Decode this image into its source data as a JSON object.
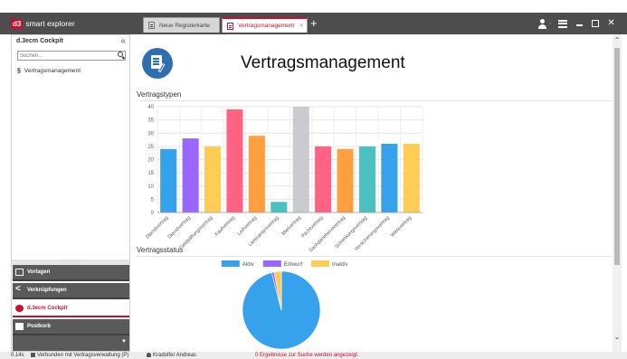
{
  "app": {
    "logo_mark": "d3",
    "logo_text": "smart explorer"
  },
  "tabs": [
    {
      "label": "Neue Registerkarte",
      "active": false
    },
    {
      "label": "Vertragsmanagement",
      "active": true
    }
  ],
  "sidebar": {
    "title": "d.3ecm Cockpit",
    "collapse_glyph": "«",
    "search_placeholder": "Suchen...",
    "tree_items": [
      {
        "symbol": "§",
        "label": "Vertragsmanagement"
      }
    ],
    "nav": [
      {
        "label": "Vorlagen",
        "icon": "document-icon",
        "active": false
      },
      {
        "label": "Verknüpfungen",
        "icon": "share-icon",
        "active": false
      },
      {
        "label": "d.3ecm Cockpit",
        "icon": "cockpit-icon",
        "active": true
      },
      {
        "label": "Postkorb",
        "icon": "mail-icon",
        "active": false
      }
    ]
  },
  "main": {
    "title": "Vertragsmanagement",
    "section_types": "Vertragstypen",
    "section_status": "Vertragsstatus"
  },
  "statusbar": {
    "time": "0.14s",
    "connection": "Verbunden mit Vertragsverwaltung (P)",
    "user": "Kradolfer Andreas",
    "message": "0 Ergebnisse zur Suche werden angezeigt."
  },
  "chart_data": [
    {
      "type": "bar",
      "categories": [
        "Dienstvertrag",
        "Dienstvertrag",
        "Geldstiftungsvertrag",
        "Kaufvertrag",
        "Leihvertrag",
        "Lieferantenvertrag",
        "Mietvertrag",
        "Pachtvertrag",
        "Sachdarlehensvertrag",
        "Schenkungsvertrag",
        "Versicherungsvertrag",
        "Werkvertrag"
      ],
      "values": [
        24,
        28,
        25,
        39,
        29,
        4,
        40,
        25,
        24,
        25,
        26,
        26
      ],
      "colors": [
        "#36a2eb",
        "#9966ff",
        "#ffcd56",
        "#ff6384",
        "#ff9f40",
        "#4bc0c0",
        "#c9cbcf",
        "#ff6384",
        "#ff9f40",
        "#4bc0c0",
        "#36a2eb",
        "#ffcd56"
      ],
      "ylim": [
        0,
        40
      ],
      "yticks": [
        0,
        5,
        10,
        15,
        20,
        25,
        30,
        35,
        40
      ],
      "grid": true
    },
    {
      "type": "pie",
      "legend_position": "top",
      "series": [
        {
          "name": "Aktiv",
          "value": 96,
          "color": "#36a2eb"
        },
        {
          "name": "Entwurf",
          "value": 1,
          "color": "#9966ff"
        },
        {
          "name": "Inaktiv",
          "value": 3,
          "color": "#ffcd56"
        }
      ]
    }
  ]
}
